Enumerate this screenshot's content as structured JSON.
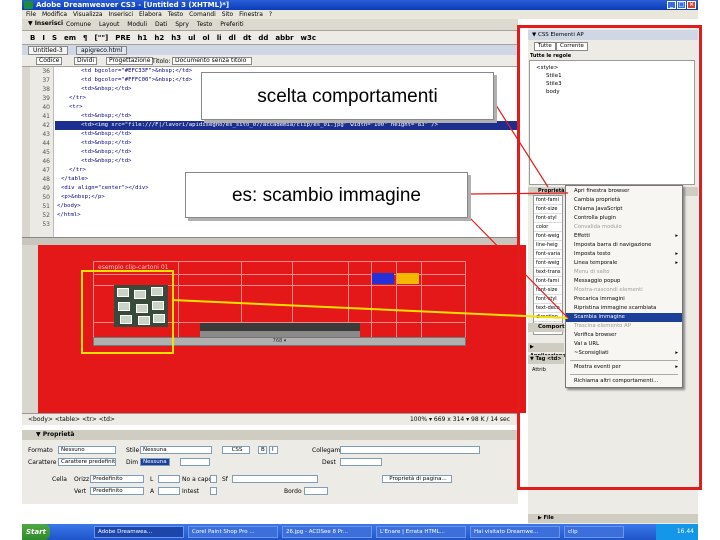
{
  "window": {
    "title": "Adobe Dreamweaver CS3 - [Untitled 3 (XHTML)*]"
  },
  "menubar": [
    "File",
    "Modifica",
    "Visualizza",
    "Inserisci",
    "Elabora",
    "Testo",
    "Comandi",
    "Sito",
    "Finestra",
    "?"
  ],
  "insertbar": {
    "label": "▼ Inserisci",
    "tabs": [
      "Comune",
      "Layout",
      "Moduli",
      "Dati",
      "Spry",
      "Testo",
      "Preferiti"
    ]
  },
  "toolbar": [
    "B",
    "I",
    "S",
    "em",
    "¶",
    "[\"\"]",
    "PRE",
    "h1",
    "h2",
    "h3",
    "ul",
    "ol",
    "li",
    "dl",
    "dt",
    "dd",
    "abbr",
    "w3c"
  ],
  "doctabs": [
    "Untitled-3",
    "apigreco.html"
  ],
  "viewbar": {
    "code_btn": "Codice",
    "split_btn": "Dividi",
    "design_btn": "Progettazione",
    "title_label": "Titolo:",
    "title_value": "Documento senza titolo"
  },
  "line_numbers": [
    "36",
    "37",
    "38",
    "39",
    "40",
    "41",
    "42",
    "43",
    "44",
    "45",
    "46",
    "47",
    "48",
    "49",
    "50",
    "51",
    "52",
    "53"
  ],
  "code_lines": [
    "<td bgcolor=\"#EFC33F\">&nbsp;</td>",
    "<td bgcolor=\"#FFFC00\">&nbsp;</td>",
    "<td>&nbsp;</td>",
    "</tr>",
    "<tr>",
    "<td>&nbsp;</td>",
    "<td><img src=\"file:///F|/lavori/apidisegno/es_sito_07/accademia/clip/es_01.jpg\" width=\"100\" height=\"83\" />",
    "<td>&nbsp;</td>",
    "<td>&nbsp;</td>",
    "<td>&nbsp;</td>",
    "<td>&nbsp;</td>",
    "</tr>",
    "</table>",
    "<div align=\"center\"></div>",
    "<p>&nbsp;</p>",
    "</body>",
    "</html>",
    ""
  ],
  "design": {
    "table_title": "esempio clip-cartoni 01",
    "bottom_bar": "768 ▾"
  },
  "statusbar": {
    "path": "<body> <table> <tr> <td>",
    "right": "100% ▾  669 x 314 ▾  98 K / 14 sec"
  },
  "properties": {
    "header": "▼ Proprietà",
    "formato_label": "Formato",
    "formato_value": "Nessuno",
    "carattere_label": "Carattere",
    "carattere_value": "Carattere predefinito",
    "stile_label": "Stile",
    "stile_value": "Nessuna",
    "dim_label": "Dim",
    "dim_value": "Nessuna",
    "css_btn": "CSS",
    "collegam_label": "Collegam",
    "dest_label": "Dest",
    "cella_label": "Cella",
    "orizz_label": "Orizz",
    "orizz_value": "Predefinito",
    "vert_label": "Vert",
    "vert_value": "Predefinito",
    "l_label": "L",
    "a_label": "A",
    "nocapo_label": "No a capo",
    "int_label": "Intest",
    "sf_label": "Sf",
    "bordo_label": "Bordo",
    "page_btn": "Proprietà di pagina..."
  },
  "css_panel": {
    "tabs": "▼ CSS  Elementi AP",
    "tutte_btn": "Tutte",
    "corrente_btn": "Corrente",
    "rules_title": "Tutte le regole",
    "rules": [
      "<style>",
      "Stile1",
      "Stile3",
      "body"
    ],
    "prop_rows": [
      "font-fami",
      "font-size",
      "font-styl",
      "color",
      "font-weig",
      "line-heig",
      "font-varia",
      "font-weig",
      "text-trans",
      "font-fami",
      "font-size",
      "font-styl",
      "text-deco",
      "direction",
      "unicode"
    ]
  },
  "panel_headers": {
    "props": "Proprietà di: .Stile1",
    "comportamenti": "Comport",
    "applicazione": "▶ Applicazione",
    "tag": "▼ Tag <td>",
    "file": "▶ File",
    "attrib": "Attrib"
  },
  "context_menu": {
    "items": [
      "Apri finestra browser",
      "Cambia proprietà",
      "Chiama JavaScript",
      "Controlla plugin",
      "Convalida modulo",
      "Effetti",
      "Imposta barra di navigazione",
      "Imposta testo",
      "Linea temporale",
      "Menu di salto",
      "Messaggio popup",
      "Mostra-nascondi elementi",
      "Precarica immagini",
      "Ripristina immagine scambiata",
      "Scambia immagine",
      "Trascina elemento AP",
      "Verifica browser",
      "Vai a URL",
      "~Sconsigliati",
      "Mostra eventi per",
      "Richiama altri comportamenti..."
    ],
    "selected_index": 14
  },
  "callouts": {
    "c1": "scelta comportamenti",
    "c2": "es: scambio immagine"
  },
  "taskbar": {
    "start": "Start",
    "tasks": [
      "Adobe Dreamwea...",
      "Corel Paint Shop Pro ...",
      "26.jpg - ACDSee 8 Pr...",
      "L'Enare | Errata HTML...",
      "Hai visitato Dreamwe...",
      "clip"
    ],
    "clock": "16.44"
  },
  "colors": {
    "accent_red": "#e41818",
    "highlight": "#f5e000",
    "menu_selected": "#1c3f99"
  }
}
